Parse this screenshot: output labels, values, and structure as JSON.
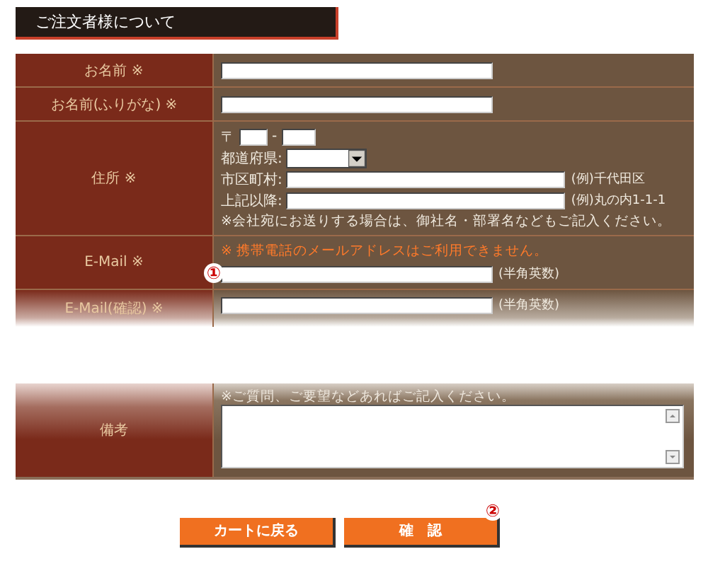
{
  "title": "ご注文者様について",
  "rows": [
    {
      "label": "お名前 ※",
      "kind": "text"
    },
    {
      "label": "お名前(ふりがな) ※",
      "kind": "text"
    },
    {
      "label": "住所 ※",
      "kind": "address",
      "postal_mark": "〒",
      "postal_sep": "-",
      "prefecture_label": "都道府県:",
      "lines": [
        {
          "label": "市区町村:",
          "hint": "(例)千代田区"
        },
        {
          "label": "上記以降:",
          "hint": "(例)丸の内1-1-1"
        }
      ],
      "note": "※会社宛にお送りする場合は、御社名・部署名などもご記入ください。"
    },
    {
      "label": "E-Mail ※",
      "kind": "email",
      "warning": "※ 携帯電話のメールアドレスはご利用できません。",
      "hint": "(半角英数)",
      "marker": "①"
    },
    {
      "label": "E-Mail(確認) ※",
      "kind": "confirm",
      "hint": "(半角英数)"
    },
    {
      "label": "備考",
      "kind": "textarea",
      "note": "※ご質問、ご要望などあればご記入ください。"
    }
  ],
  "buttons": [
    {
      "label": "カートに戻る"
    },
    {
      "label": "確　認",
      "marker": "②"
    }
  ]
}
